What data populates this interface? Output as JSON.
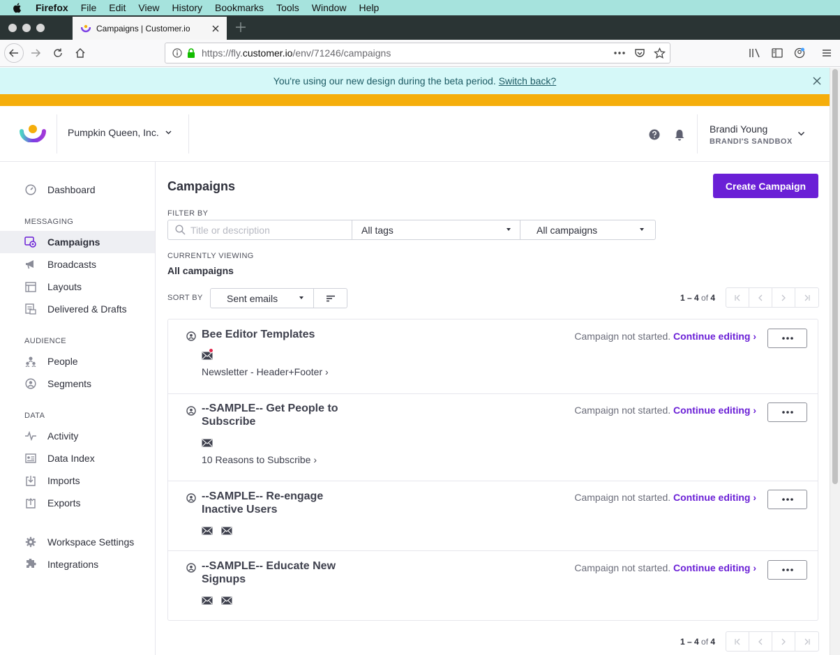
{
  "menubar": {
    "items": [
      "Firefox",
      "File",
      "Edit",
      "View",
      "History",
      "Bookmarks",
      "Tools",
      "Window",
      "Help"
    ]
  },
  "browser": {
    "tab_title": "Campaigns | Customer.io",
    "url_prefix": "https://fly.",
    "url_domain": "customer.io",
    "url_path": "/env/71246/campaigns"
  },
  "banner": {
    "text": "You're using our new design during the beta period.",
    "link": "Switch back?"
  },
  "header": {
    "workspace": "Pumpkin Queen, Inc.",
    "user_name": "Brandi Young",
    "user_workspace": "BRANDI'S SANDBOX"
  },
  "sidebar": {
    "dashboard": "Dashboard",
    "sections": [
      {
        "title": "MESSAGING",
        "items": [
          "Campaigns",
          "Broadcasts",
          "Layouts",
          "Delivered & Drafts"
        ]
      },
      {
        "title": "AUDIENCE",
        "items": [
          "People",
          "Segments"
        ]
      },
      {
        "title": "DATA",
        "items": [
          "Activity",
          "Data Index",
          "Imports",
          "Exports"
        ]
      }
    ],
    "bottom": [
      "Workspace Settings",
      "Integrations"
    ],
    "active": "Campaigns"
  },
  "main": {
    "title": "Campaigns",
    "create_button": "Create Campaign",
    "filter_label": "FILTER BY",
    "search_placeholder": "Title or description",
    "tags_select": "All tags",
    "campaigns_select": "All campaigns",
    "viewing_label": "CURRENTLY VIEWING",
    "viewing_value": "All campaigns",
    "sort_label": "SORT BY",
    "sort_value": "Sent emails",
    "pager_range": "1 – 4",
    "pager_of": "of",
    "pager_total": "4"
  },
  "campaigns": [
    {
      "name": "Bee Editor Templates",
      "status": "Campaign not started.",
      "action": "Continue editing ›",
      "emails": 1,
      "message": "Newsletter - Header+Footer ›"
    },
    {
      "name": "--SAMPLE-- Get People to Subscribe",
      "status": "Campaign not started.",
      "action": "Continue editing ›",
      "emails": 1,
      "message": "10 Reasons to Subscribe ›"
    },
    {
      "name": "--SAMPLE-- Re-engage Inactive Users",
      "status": "Campaign not started.",
      "action": "Continue editing ›",
      "emails": 2,
      "message": ""
    },
    {
      "name": "--SAMPLE-- Educate New Signups",
      "status": "Campaign not started.",
      "action": "Continue editing ›",
      "emails": 2,
      "message": ""
    }
  ],
  "colors": {
    "accent": "#6a1fd6",
    "banner_bg": "#d5f8f8",
    "warning_bar": "#f5ae0b",
    "menubar_bg": "#a6e3dd"
  }
}
